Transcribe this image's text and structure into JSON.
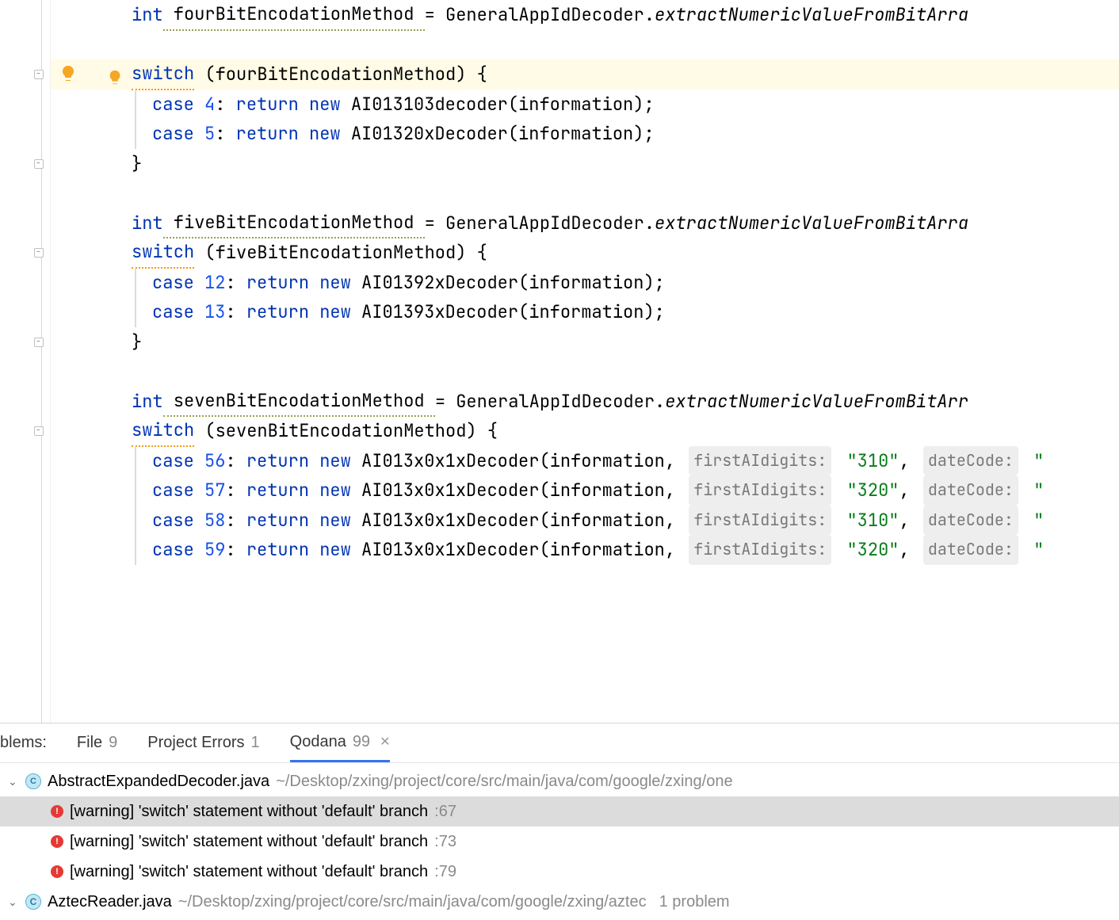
{
  "editor": {
    "lines": [
      {
        "indent": 2,
        "tokens": [
          {
            "t": "kw",
            "v": "int"
          },
          {
            "t": "ident",
            "v": " fourBitEncodationMethod ",
            "squiggle": "olive",
            "start": " ",
            "end": ""
          },
          {
            "t": "punct",
            "v": "= "
          },
          {
            "t": "type",
            "v": "GeneralAppIdDecoder"
          },
          {
            "t": "punct",
            "v": "."
          },
          {
            "t": "method-call",
            "v": "extractNumericValueFromBitArra"
          }
        ]
      },
      {
        "indent": 0,
        "tokens": []
      },
      {
        "indent": 2,
        "highlight": true,
        "bulb": true,
        "fold": true,
        "tokens": [
          {
            "t": "kw",
            "v": "switch",
            "squiggle": "warn"
          },
          {
            "t": "punct",
            "v": " ("
          },
          {
            "t": "ident",
            "v": "fourBitEncodationMethod"
          },
          {
            "t": "punct",
            "v": ") {"
          }
        ]
      },
      {
        "indent": 3,
        "nest": 1,
        "tokens": [
          {
            "t": "kw",
            "v": "case"
          },
          {
            "t": "num",
            "v": " 4"
          },
          {
            "t": "punct",
            "v": ": "
          },
          {
            "t": "kw",
            "v": "return"
          },
          {
            "t": "punct",
            "v": " "
          },
          {
            "t": "kw",
            "v": "new"
          },
          {
            "t": "type",
            "v": " AI013103decoder"
          },
          {
            "t": "punct",
            "v": "(information);"
          }
        ]
      },
      {
        "indent": 3,
        "nest": 1,
        "tokens": [
          {
            "t": "kw",
            "v": "case"
          },
          {
            "t": "num",
            "v": " 5"
          },
          {
            "t": "punct",
            "v": ": "
          },
          {
            "t": "kw",
            "v": "return"
          },
          {
            "t": "punct",
            "v": " "
          },
          {
            "t": "kw",
            "v": "new"
          },
          {
            "t": "type",
            "v": " AI01320xDecoder"
          },
          {
            "t": "punct",
            "v": "(information);"
          }
        ]
      },
      {
        "indent": 2,
        "fold_close": true,
        "tokens": [
          {
            "t": "punct",
            "v": "}"
          }
        ]
      },
      {
        "indent": 0,
        "tokens": []
      },
      {
        "indent": 2,
        "tokens": [
          {
            "t": "kw",
            "v": "int"
          },
          {
            "t": "ident",
            "v": " fiveBitEncodationMethod ",
            "squiggle": "olive",
            "start": " "
          },
          {
            "t": "punct",
            "v": "= "
          },
          {
            "t": "type",
            "v": "GeneralAppIdDecoder"
          },
          {
            "t": "punct",
            "v": "."
          },
          {
            "t": "method-call",
            "v": "extractNumericValueFromBitArra"
          }
        ]
      },
      {
        "indent": 2,
        "fold": true,
        "tokens": [
          {
            "t": "kw",
            "v": "switch",
            "squiggle": "warn"
          },
          {
            "t": "punct",
            "v": " ("
          },
          {
            "t": "ident",
            "v": "fiveBitEncodationMethod"
          },
          {
            "t": "punct",
            "v": ") {"
          }
        ]
      },
      {
        "indent": 3,
        "nest": 1,
        "tokens": [
          {
            "t": "kw",
            "v": "case"
          },
          {
            "t": "num",
            "v": " 12"
          },
          {
            "t": "punct",
            "v": ": "
          },
          {
            "t": "kw",
            "v": "return"
          },
          {
            "t": "punct",
            "v": " "
          },
          {
            "t": "kw",
            "v": "new"
          },
          {
            "t": "type",
            "v": " AI01392xDecoder"
          },
          {
            "t": "punct",
            "v": "(information);"
          }
        ]
      },
      {
        "indent": 3,
        "nest": 1,
        "tokens": [
          {
            "t": "kw",
            "v": "case"
          },
          {
            "t": "num",
            "v": " 13"
          },
          {
            "t": "punct",
            "v": ": "
          },
          {
            "t": "kw",
            "v": "return"
          },
          {
            "t": "punct",
            "v": " "
          },
          {
            "t": "kw",
            "v": "new"
          },
          {
            "t": "type",
            "v": " AI01393xDecoder"
          },
          {
            "t": "punct",
            "v": "(information);"
          }
        ]
      },
      {
        "indent": 2,
        "fold_close": true,
        "tokens": [
          {
            "t": "punct",
            "v": "}"
          }
        ]
      },
      {
        "indent": 0,
        "tokens": []
      },
      {
        "indent": 2,
        "tokens": [
          {
            "t": "kw",
            "v": "int"
          },
          {
            "t": "ident",
            "v": " sevenBitEncodationMethod ",
            "squiggle": "olive"
          },
          {
            "t": "punct",
            "v": "= "
          },
          {
            "t": "type",
            "v": "GeneralAppIdDecoder"
          },
          {
            "t": "punct",
            "v": "."
          },
          {
            "t": "method-call",
            "v": "extractNumericValueFromBitArr"
          }
        ]
      },
      {
        "indent": 2,
        "fold": true,
        "tokens": [
          {
            "t": "kw",
            "v": "switch",
            "squiggle": "warn"
          },
          {
            "t": "punct",
            "v": " ("
          },
          {
            "t": "ident",
            "v": "sevenBitEncodationMethod"
          },
          {
            "t": "punct",
            "v": ") {"
          }
        ]
      },
      {
        "indent": 3,
        "nest": 1,
        "tokens": [
          {
            "t": "kw",
            "v": "case"
          },
          {
            "t": "num",
            "v": " 56"
          },
          {
            "t": "punct",
            "v": ": "
          },
          {
            "t": "kw",
            "v": "return"
          },
          {
            "t": "punct",
            "v": " "
          },
          {
            "t": "kw",
            "v": "new"
          },
          {
            "t": "type",
            "v": " AI013x0x1xDecoder"
          },
          {
            "t": "punct",
            "v": "(information, "
          },
          {
            "t": "hint",
            "v": "firstAIdigits:"
          },
          {
            "t": "str",
            "v": " \"310\""
          },
          {
            "t": "punct",
            "v": ", "
          },
          {
            "t": "hint",
            "v": "dateCode:"
          },
          {
            "t": "str",
            "v": " \""
          }
        ]
      },
      {
        "indent": 3,
        "nest": 1,
        "tokens": [
          {
            "t": "kw",
            "v": "case"
          },
          {
            "t": "num",
            "v": " 57"
          },
          {
            "t": "punct",
            "v": ": "
          },
          {
            "t": "kw",
            "v": "return"
          },
          {
            "t": "punct",
            "v": " "
          },
          {
            "t": "kw",
            "v": "new"
          },
          {
            "t": "type",
            "v": " AI013x0x1xDecoder"
          },
          {
            "t": "punct",
            "v": "(information, "
          },
          {
            "t": "hint",
            "v": "firstAIdigits:"
          },
          {
            "t": "str",
            "v": " \"320\""
          },
          {
            "t": "punct",
            "v": ", "
          },
          {
            "t": "hint",
            "v": "dateCode:"
          },
          {
            "t": "str",
            "v": " \""
          }
        ]
      },
      {
        "indent": 3,
        "nest": 1,
        "tokens": [
          {
            "t": "kw",
            "v": "case"
          },
          {
            "t": "num",
            "v": " 58"
          },
          {
            "t": "punct",
            "v": ": "
          },
          {
            "t": "kw",
            "v": "return"
          },
          {
            "t": "punct",
            "v": " "
          },
          {
            "t": "kw",
            "v": "new"
          },
          {
            "t": "type",
            "v": " AI013x0x1xDecoder"
          },
          {
            "t": "punct",
            "v": "(information, "
          },
          {
            "t": "hint",
            "v": "firstAIdigits:"
          },
          {
            "t": "str",
            "v": " \"310\""
          },
          {
            "t": "punct",
            "v": ", "
          },
          {
            "t": "hint",
            "v": "dateCode:"
          },
          {
            "t": "str",
            "v": " \""
          }
        ]
      },
      {
        "indent": 3,
        "nest": 1,
        "tokens": [
          {
            "t": "kw",
            "v": "case"
          },
          {
            "t": "num",
            "v": " 59"
          },
          {
            "t": "punct",
            "v": ": "
          },
          {
            "t": "kw",
            "v": "return"
          },
          {
            "t": "punct",
            "v": " "
          },
          {
            "t": "kw",
            "v": "new"
          },
          {
            "t": "type",
            "v": " AI013x0x1xDecoder"
          },
          {
            "t": "punct",
            "v": "(information, "
          },
          {
            "t": "hint",
            "v": "firstAIdigits:"
          },
          {
            "t": "str",
            "v": " \"320\""
          },
          {
            "t": "punct",
            "v": ", "
          },
          {
            "t": "hint",
            "v": "dateCode:"
          },
          {
            "t": "str",
            "v": " \""
          }
        ]
      }
    ]
  },
  "problems": {
    "lead_label": "blems:",
    "tabs": [
      {
        "label": "File",
        "count": "9",
        "active": false
      },
      {
        "label": "Project Errors",
        "count": "1",
        "active": false
      },
      {
        "label": "Qodana",
        "count": "99",
        "active": true,
        "closable": true
      }
    ],
    "tree": [
      {
        "kind": "file",
        "icon": "interface",
        "name": "AbstractExpandedDecoder.java",
        "path": "~/Desktop/zxing/project/core/src/main/java/com/google/zxing/one",
        "expanded": true
      },
      {
        "kind": "warning",
        "text": "[warning] 'switch' statement without 'default' branch",
        "line": ":67",
        "selected": true
      },
      {
        "kind": "warning",
        "text": "[warning] 'switch' statement without 'default' branch",
        "line": ":73"
      },
      {
        "kind": "warning",
        "text": "[warning] 'switch' statement without 'default' branch",
        "line": ":79"
      },
      {
        "kind": "file",
        "icon": "class",
        "name": "AztecReader.java",
        "path": "~/Desktop/zxing/project/core/src/main/java/com/google/zxing/aztec",
        "trailing": "1 problem",
        "expanded": true
      }
    ]
  }
}
